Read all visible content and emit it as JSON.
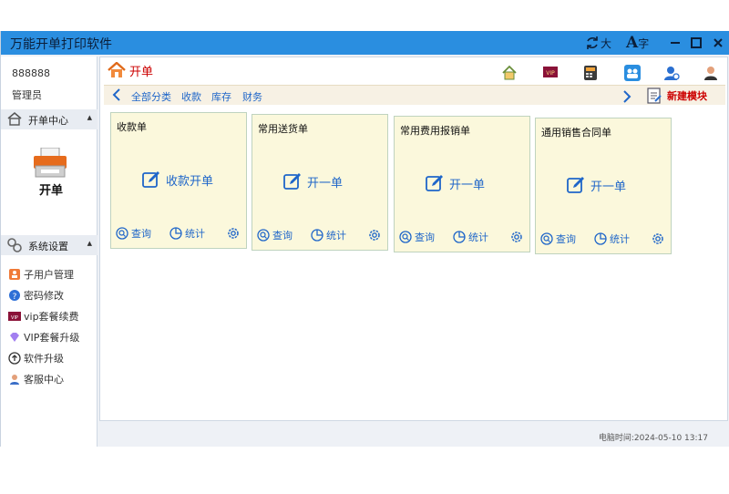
{
  "window": {
    "title": "万能开单打印软件",
    "title_bar": {
      "font_large_label": "大",
      "font_char_label": "字",
      "font_char_glyph": "A"
    }
  },
  "sidebar": {
    "user_id": "888888",
    "user_role": "管理员",
    "sections": [
      {
        "label": "开单中心",
        "icon": "house-icon"
      },
      {
        "label": "系统设置",
        "icon": "gears-icon"
      }
    ],
    "open_order_label": "开单",
    "settings_items": [
      {
        "label": "子用户管理",
        "icon": "sub-user-icon"
      },
      {
        "label": "密码修改",
        "icon": "question-icon"
      },
      {
        "label": "vip套餐续费",
        "icon": "vip-icon"
      },
      {
        "label": "VIP套餐升级",
        "icon": "diamond-icon"
      },
      {
        "label": "软件升级",
        "icon": "upgrade-icon"
      },
      {
        "label": "客服中心",
        "icon": "customer-service-icon"
      }
    ]
  },
  "main": {
    "title": "开单",
    "header_icons": [
      "home-icon",
      "vip-icon",
      "calculator-icon",
      "group-icon",
      "user-settings-icon",
      "avatar-icon"
    ],
    "vip_badge": "VIP",
    "categories": [
      "全部分类",
      "收款",
      "库存",
      "财务"
    ],
    "new_module_label": "新建模块",
    "cards": [
      {
        "name": "收款单",
        "action": "收款开单",
        "query": "查询",
        "stats": "统计"
      },
      {
        "name": "常用送货单",
        "action": "开一单",
        "query": "查询",
        "stats": "统计"
      },
      {
        "name": "常用费用报销单",
        "action": "开一单",
        "query": "查询",
        "stats": "统计"
      },
      {
        "name": "通用销售合同单",
        "action": "开一单",
        "query": "查询",
        "stats": "统计"
      }
    ]
  },
  "status": {
    "computer_time": "电脑时间:2024-05-10 13:17"
  },
  "colors": {
    "titlebar": "#2a8ee0",
    "accent_blue": "#1f66c9",
    "accent_red": "#cc0000",
    "card_bg": "#fbf8dc"
  }
}
